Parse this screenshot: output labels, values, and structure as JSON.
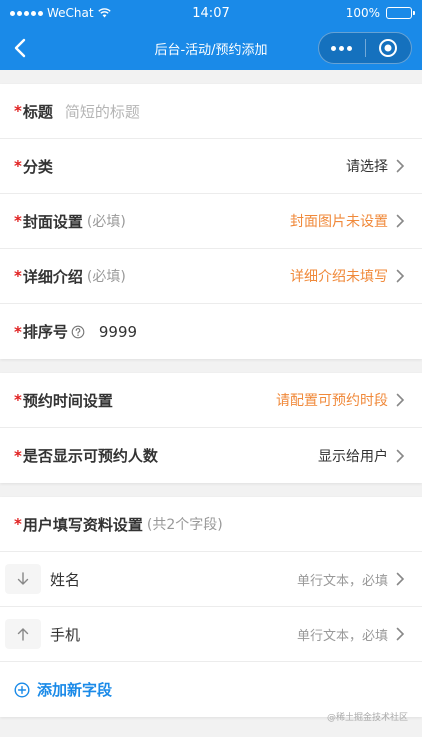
{
  "status_bar": {
    "carrier": "WeChat",
    "time": "14:07",
    "battery": "100%"
  },
  "nav": {
    "title": "后台-活动/预约添加"
  },
  "basic": {
    "title_label": "标题",
    "title_placeholder": "简短的标题",
    "category_label": "分类",
    "category_value": "请选择",
    "cover_label": "封面设置",
    "cover_sub": "(必填)",
    "cover_value": "封面图片未设置",
    "detail_label": "详细介绍",
    "detail_sub": "(必填)",
    "detail_value": "详细介绍未填写",
    "sort_label": "排序号",
    "sort_value": "9999"
  },
  "booking": {
    "time_label": "预约时间设置",
    "time_value": "请配置可预约时段",
    "show_count_label": "是否显示可预约人数",
    "show_count_value": "显示给用户"
  },
  "user_fields": {
    "label": "用户填写资料设置",
    "sub": "(共2个字段)",
    "fields": [
      {
        "name": "姓名",
        "desc": "单行文本，必填",
        "move": "down"
      },
      {
        "name": "手机",
        "desc": "单行文本，必填",
        "move": "up"
      }
    ],
    "add_label": "添加新字段"
  },
  "required_mark": "*",
  "watermark": "@稀土掘金技术社区",
  "colors": {
    "primary": "#1a8ae8",
    "required": "#e02020",
    "warning": "#f0893a"
  }
}
